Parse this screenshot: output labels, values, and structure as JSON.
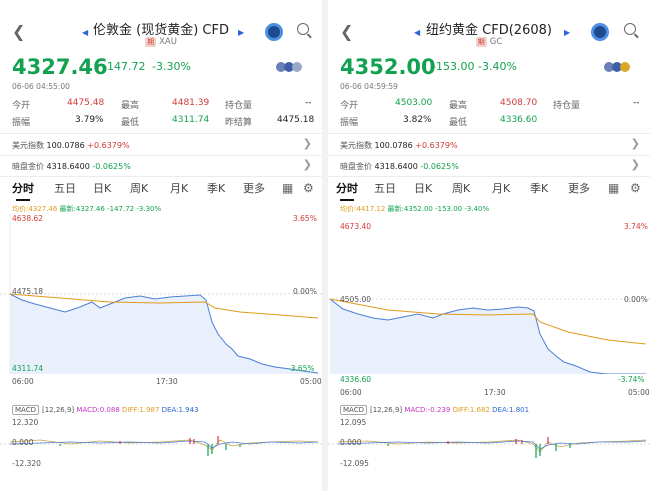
{
  "left": {
    "title": "伦敦金 (现货黄金) CFD",
    "tag": "期",
    "code": "XAU",
    "price": "4327.46",
    "change": "-147.72",
    "change_pct": "-3.30%",
    "timestamp": "06-06 04:55:00",
    "stats": {
      "open_label": "今开",
      "open": "4475.48",
      "high_label": "最高",
      "high": "4481.39",
      "oi_label": "持仓量",
      "oi": "--",
      "amp_label": "振幅",
      "amp": "3.79%",
      "low_label": "最低",
      "low": "4311.74",
      "prev_label": "昨结算",
      "prev": "4475.18"
    },
    "usd_index_label": "美元指数",
    "usd_index": "100.0786",
    "usd_index_chg": "+0.6379%",
    "dark_label": "暗盘金价",
    "dark": "4318.6400",
    "dark_chg": "-0.0625%",
    "avg_label": "均价:",
    "avg": "4327.46",
    "latest_label": "最新:",
    "latest": "4327.46",
    "latest_chg": "-147.72",
    "latest_pct": "-3.30%",
    "y_top": "4638.62",
    "y_mid": "4475.18",
    "y_bot": "4311.74",
    "pct_top": "3.65%",
    "pct_mid": "0.00%",
    "pct_bot": "-3.65%",
    "x_start": "06:00",
    "x_mid": "17:30",
    "x_end": "05:00",
    "macd_box": "MACD",
    "macd_params": "[12,26,9]",
    "macd": "MACD:0.088",
    "diff": "DIFF:1.987",
    "dea": "DEA:1.943",
    "macd_top": "12.320",
    "macd_mid": "0.000",
    "macd_bot": "-12.320"
  },
  "right": {
    "title": "纽约黄金 CFD(2608)",
    "tag": "期",
    "code": "GC",
    "price": "4352.00",
    "change": "-153.00",
    "change_pct": "-3.40%",
    "timestamp": "06-06 04:59:59",
    "stats": {
      "open_label": "今开",
      "open": "4503.00",
      "high_label": "最高",
      "high": "4508.70",
      "oi_label": "持仓量",
      "oi": "--",
      "amp_label": "振幅",
      "amp": "3.82%",
      "low_label": "最低",
      "low": "4336.60",
      "prev_label": "",
      "prev": ""
    },
    "usd_index_label": "美元指数",
    "usd_index": "100.0786",
    "usd_index_chg": "+0.6379%",
    "dark_label": "暗盘金价",
    "dark": "4318.6400",
    "dark_chg": "-0.0625%",
    "avg_label": "均价:",
    "avg": "4417.12",
    "latest_label": "最新:",
    "latest": "4352.00",
    "latest_chg": "-153.00",
    "latest_pct": "-3.40%",
    "y_top": "4673.40",
    "y_mid": "4505.00",
    "y_bot": "4336.60",
    "pct_top": "3.74%",
    "pct_mid": "0.00%",
    "pct_bot": "-3.74%",
    "x_start": "06:00",
    "x_mid": "17:30",
    "x_end": "05:00",
    "macd_box": "MACD",
    "macd_params": "[12,26,9]",
    "macd": "MACD:-0.239",
    "diff": "DIFF:1.682",
    "dea": "DEA:1.801",
    "macd_top": "12.095",
    "macd_mid": "0.000",
    "macd_bot": "-12.095"
  },
  "tabs": [
    "分时",
    "五日",
    "日K",
    "周K",
    "月K",
    "季K",
    "更多"
  ],
  "icons": {
    "back": "back-icon",
    "prev": "prev-icon",
    "next": "next-icon",
    "logo": "app-logo-icon",
    "search": "search-icon",
    "grid": "grid-icon",
    "settings": "settings-icon"
  },
  "colors": {
    "up": "#d23a3a",
    "down": "#12a150",
    "avg": "#e09a1a",
    "price_line": "#2a66d9"
  }
}
